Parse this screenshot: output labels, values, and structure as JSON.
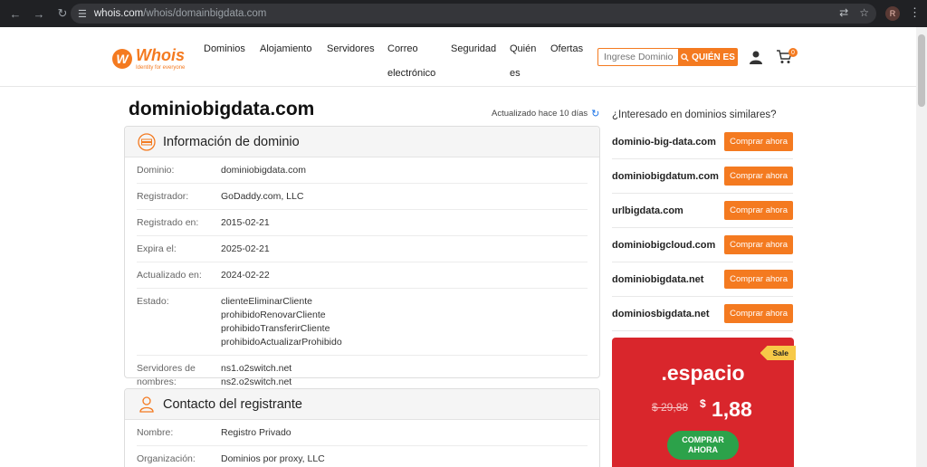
{
  "browser": {
    "url_host": "whois.com",
    "url_path": "/whois/domainbigdata.com",
    "profile_initial": "R"
  },
  "header": {
    "logo_brand": "Whois",
    "logo_tagline": "Identity for everyone",
    "menu": [
      "Dominios",
      "Alojamiento",
      "Servidores",
      "Correo",
      "electrónico",
      "Seguridad",
      "Quién",
      "es",
      "Ofertas"
    ],
    "search_placeholder": "Ingrese Dominio o IP",
    "search_button": "QUIÉN ES",
    "cart_count": "0"
  },
  "main": {
    "title": "dominiobigdata.com",
    "updated": "Actualizado hace 10 días"
  },
  "domain_info": {
    "title": "Información de dominio",
    "rows": [
      {
        "label": "Dominio:",
        "value": [
          "dominiobigdata.com"
        ]
      },
      {
        "label": "Registrador:",
        "value": [
          "GoDaddy.com, LLC"
        ]
      },
      {
        "label": "Registrado en:",
        "value": [
          "2015-02-21"
        ]
      },
      {
        "label": "Expira el:",
        "value": [
          "2025-02-21"
        ]
      },
      {
        "label": "Actualizado en:",
        "value": [
          "2024-02-22"
        ]
      },
      {
        "label": "Estado:",
        "value": [
          "clienteEliminarCliente",
          "prohibidoRenovarCliente",
          "prohibidoTransferirCliente",
          "prohibidoActualizarProhibido"
        ]
      },
      {
        "label": "Servidores de nombres:",
        "value": [
          "ns1.o2switch.net",
          "ns2.o2switch.net"
        ]
      }
    ]
  },
  "registrant": {
    "title": "Contacto del registrante",
    "rows": [
      {
        "label": "Nombre:",
        "value": [
          "Registro Privado"
        ]
      },
      {
        "label": "Organización:",
        "value": [
          "Dominios por proxy, LLC"
        ]
      }
    ]
  },
  "sidebar": {
    "heading": "¿Interesado en dominios similares?",
    "buy_label": "Comprar ahora",
    "suggestions": [
      "dominio-big-data.com",
      "dominiobigdatum.com",
      "urlbigdata.com",
      "dominiobigcloud.com",
      "dominiobigdata.net",
      "dominiosbigdata.net"
    ]
  },
  "promo": {
    "badge": "Sale",
    "tld": ".espacio",
    "old_price": "$ 29,88",
    "currency": "$",
    "new_price": "1,88",
    "cta_line1": "COMPRAR",
    "cta_line2": "AHORA"
  },
  "colors": {
    "accent": "#f47a20",
    "promo_bg": "#d9262c",
    "cta": "#2ca24a",
    "sale_badge": "#f7c948"
  }
}
